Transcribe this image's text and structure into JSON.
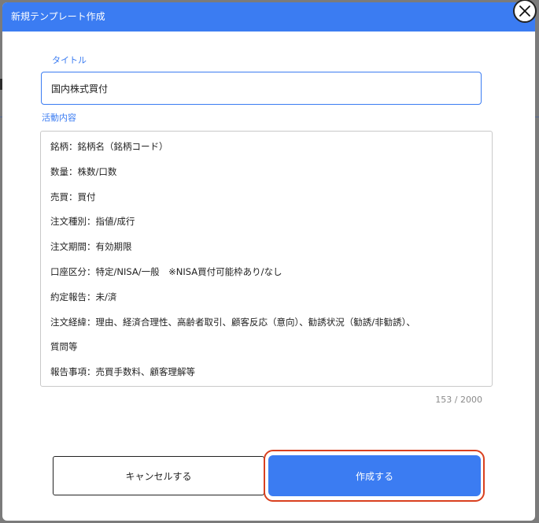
{
  "dialog": {
    "title": "新規テンプレート作成"
  },
  "form": {
    "title_label": "タイトル",
    "title_value": "国内株式買付",
    "content_label": "活動内容",
    "content_lines": [
      "銘柄：銘柄名（銘柄コード）",
      "数量：株数/口数",
      "売買：買付",
      "注文種別：指値/成行",
      "注文期間：有効期限",
      "口座区分：特定/NISA/一般　※NISA買付可能枠あり/なし",
      "約定報告：未/済",
      "注文経緯：理由、経済合理性、高齢者取引、顧客反応（意向）、勧誘状況（勧誘/非勧誘）、",
      "質問等",
      "報告事項：売買手数料、顧客理解等"
    ],
    "char_count": "153 / 2000"
  },
  "buttons": {
    "cancel_label": "キャンセルする",
    "create_label": "作成する"
  },
  "colors": {
    "accent": "#3b7cf2",
    "highlight": "#d9401f"
  }
}
